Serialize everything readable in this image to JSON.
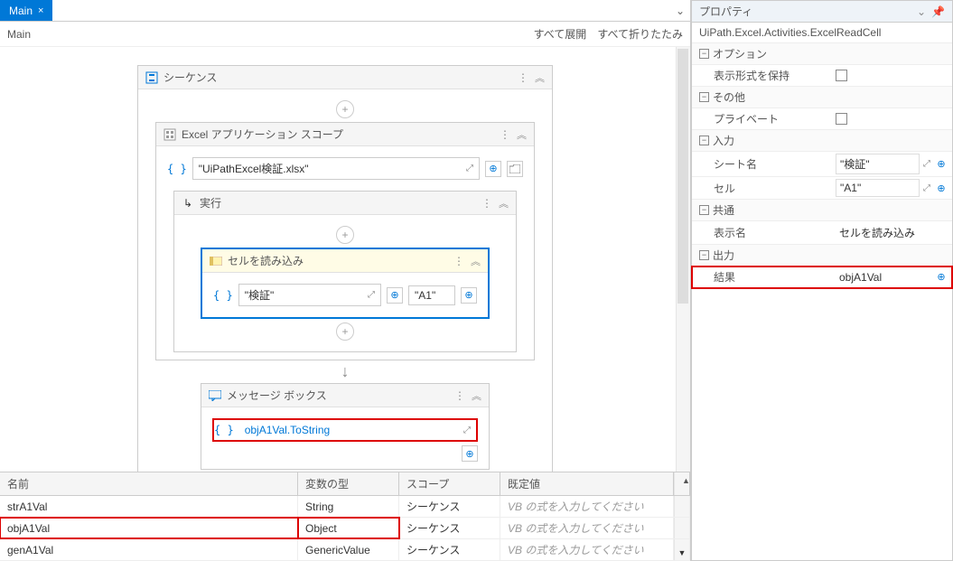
{
  "tab": {
    "title": "Main",
    "close": "×"
  },
  "breadcrumb": "Main",
  "toolbar": {
    "expand_all": "すべて展開",
    "collapse_all": "すべて折りたたみ"
  },
  "seq": {
    "title": "シーケンス"
  },
  "excel_scope": {
    "title": "Excel アプリケーション スコープ",
    "path": "\"UiPathExcel検証.xlsx\""
  },
  "exec": {
    "title": "実行"
  },
  "read_cell": {
    "title": "セルを読み込み",
    "sheet": "\"検証\"",
    "cell": "\"A1\""
  },
  "msg": {
    "title": "メッセージ ボックス",
    "value": "objA1Val.ToString"
  },
  "vars": {
    "headers": {
      "name": "名前",
      "type": "変数の型",
      "scope": "スコープ",
      "default": "既定値"
    },
    "default_placeholder": "VB の式を入力してください",
    "rows": [
      {
        "name": "strA1Val",
        "type": "String",
        "scope": "シーケンス"
      },
      {
        "name": "objA1Val",
        "type": "Object",
        "scope": "シーケンス"
      },
      {
        "name": "genA1Val",
        "type": "GenericValue",
        "scope": "シーケンス"
      }
    ]
  },
  "props": {
    "title": "プロパティ",
    "type": "UiPath.Excel.Activities.ExcelReadCell",
    "groups": {
      "options": {
        "label": "オプション",
        "preserve_format": "表示形式を保持"
      },
      "other": {
        "label": "その他",
        "private": "プライベート"
      },
      "input": {
        "label": "入力",
        "sheet": "シート名",
        "sheet_val": "\"検証\"",
        "cell": "セル",
        "cell_val": "\"A1\""
      },
      "common": {
        "label": "共通",
        "display_name": "表示名",
        "display_name_val": "セルを読み込み"
      },
      "output": {
        "label": "出力",
        "result": "結果",
        "result_val": "objA1Val"
      }
    }
  }
}
